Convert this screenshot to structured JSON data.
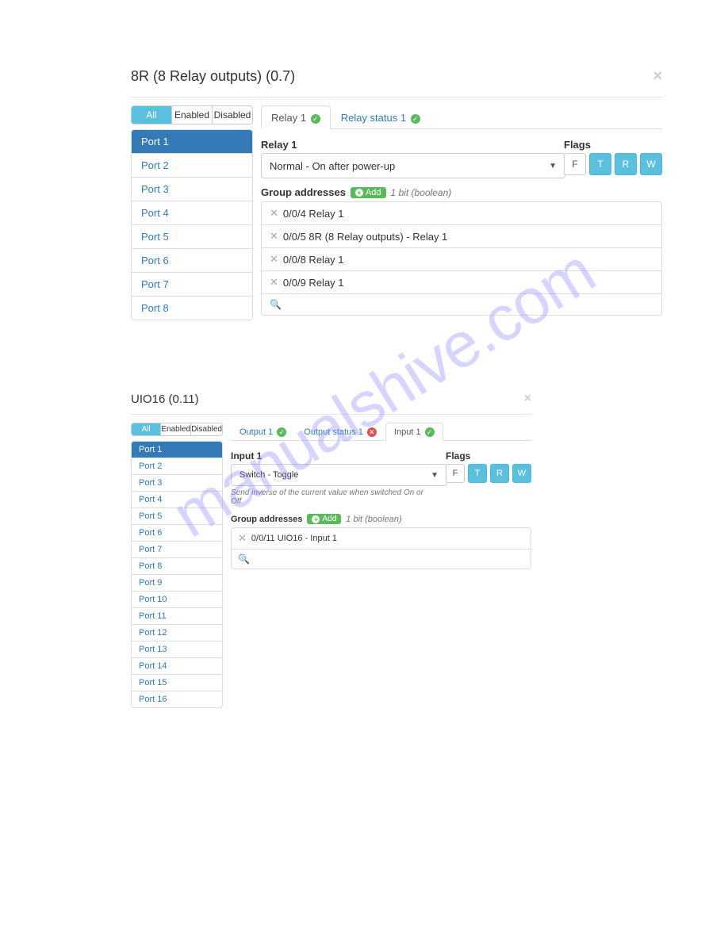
{
  "watermark": "manualshive.com",
  "panel1": {
    "title": "8R (8 Relay outputs) (0.7)",
    "filterTabs": {
      "all": "All",
      "enabled": "Enabled",
      "disabled": "Disabled"
    },
    "ports": [
      "Port 1",
      "Port 2",
      "Port 3",
      "Port 4",
      "Port 5",
      "Port 6",
      "Port 7",
      "Port 8"
    ],
    "activePort": 0,
    "tabs": [
      {
        "label": "Relay 1",
        "status": "green",
        "active": true
      },
      {
        "label": "Relay status 1",
        "status": "green",
        "active": false
      }
    ],
    "formLabel": "Relay 1",
    "selectValue": "Normal - On after power-up",
    "flagsLabel": "Flags",
    "flags": [
      {
        "letter": "F",
        "on": false
      },
      {
        "letter": "T",
        "on": true
      },
      {
        "letter": "R",
        "on": true
      },
      {
        "letter": "W",
        "on": true
      }
    ],
    "gaLabel": "Group addresses",
    "addLabel": "Add",
    "gaType": "1 bit (boolean)",
    "addresses": [
      "0/0/4 Relay 1",
      "0/0/5 8R (8 Relay outputs) - Relay 1",
      "0/0/8 Relay 1",
      "0/0/9 Relay 1"
    ]
  },
  "panel2": {
    "title": "UIO16 (0.11)",
    "filterTabs": {
      "all": "All",
      "enabled": "Enabled",
      "disabled": "Disabled"
    },
    "ports": [
      "Port 1",
      "Port 2",
      "Port 3",
      "Port 4",
      "Port 5",
      "Port 6",
      "Port 7",
      "Port 8",
      "Port 9",
      "Port 10",
      "Port 11",
      "Port 12",
      "Port 13",
      "Port 14",
      "Port 15",
      "Port 16"
    ],
    "activePort": 0,
    "tabs": [
      {
        "label": "Output 1",
        "status": "green",
        "active": false
      },
      {
        "label": "Output status 1",
        "status": "red",
        "active": false
      },
      {
        "label": "Input 1",
        "status": "green",
        "active": true
      }
    ],
    "formLabel": "Input 1",
    "selectValue": "Switch - Toggle",
    "helpText": "Send inverse of the current value when switched On or Off",
    "flagsLabel": "Flags",
    "flags": [
      {
        "letter": "F",
        "on": false
      },
      {
        "letter": "T",
        "on": true
      },
      {
        "letter": "R",
        "on": true
      },
      {
        "letter": "W",
        "on": true
      }
    ],
    "gaLabel": "Group addresses",
    "addLabel": "Add",
    "gaType": "1 bit (boolean)",
    "addresses": [
      "0/0/11 UIO16 - Input 1"
    ]
  }
}
